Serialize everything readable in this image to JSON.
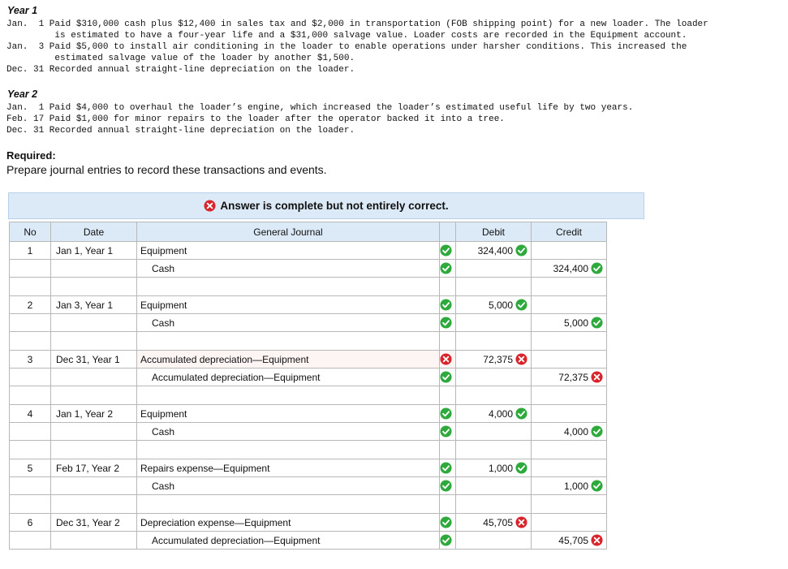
{
  "year1": {
    "title": "Year 1",
    "lines": [
      "Jan.  1 Paid $310,000 cash plus $12,400 in sales tax and $2,000 in transportation (FOB shipping point) for a new loader. The loader",
      "         is estimated to have a four-year life and a $31,000 salvage value. Loader costs are recorded in the Equipment account.",
      "Jan.  3 Paid $5,000 to install air conditioning in the loader to enable operations under harsher conditions. This increased the",
      "         estimated salvage value of the loader by another $1,500.",
      "Dec. 31 Recorded annual straight-line depreciation on the loader."
    ]
  },
  "year2": {
    "title": "Year 2",
    "lines": [
      "Jan.  1 Paid $4,000 to overhaul the loader’s engine, which increased the loader’s estimated useful life by two years.",
      "Feb. 17 Paid $1,000 for minor repairs to the loader after the operator backed it into a tree.",
      "Dec. 31 Recorded annual straight-line depreciation on the loader."
    ]
  },
  "required": {
    "title": "Required:",
    "text": "Prepare journal entries to record these transactions and events."
  },
  "banner": {
    "text": "Answer is complete but not entirely correct.",
    "icon": "x-circle-icon"
  },
  "table": {
    "headers": {
      "no": "No",
      "date": "Date",
      "journal": "General Journal",
      "debit": "Debit",
      "credit": "Credit"
    },
    "entries": [
      {
        "no": "1",
        "date": "Jan 1, Year 1",
        "debit_line": {
          "account": "Equipment",
          "status": "correct",
          "amount": "324,400",
          "amount_status": "correct"
        },
        "credit_line": {
          "account": "Cash",
          "status": "correct",
          "amount": "324,400",
          "amount_status": "correct"
        }
      },
      {
        "no": "2",
        "date": "Jan 3, Year 1",
        "debit_line": {
          "account": "Equipment",
          "status": "correct",
          "amount": "5,000",
          "amount_status": "correct"
        },
        "credit_line": {
          "account": "Cash",
          "status": "correct",
          "amount": "5,000",
          "amount_status": "correct"
        }
      },
      {
        "no": "3",
        "date": "Dec 31, Year 1",
        "debit_line": {
          "account": "Accumulated depreciation—Equipment",
          "status": "incorrect",
          "amount": "72,375",
          "amount_status": "incorrect"
        },
        "credit_line": {
          "account": "Accumulated depreciation—Equipment",
          "status": "correct",
          "amount": "72,375",
          "amount_status": "incorrect"
        }
      },
      {
        "no": "4",
        "date": "Jan 1, Year 2",
        "debit_line": {
          "account": "Equipment",
          "status": "correct",
          "amount": "4,000",
          "amount_status": "correct"
        },
        "credit_line": {
          "account": "Cash",
          "status": "correct",
          "amount": "4,000",
          "amount_status": "correct"
        }
      },
      {
        "no": "5",
        "date": "Feb 17, Year 2",
        "debit_line": {
          "account": "Repairs expense—Equipment",
          "status": "correct",
          "amount": "1,000",
          "amount_status": "correct"
        },
        "credit_line": {
          "account": "Cash",
          "status": "correct",
          "amount": "1,000",
          "amount_status": "correct"
        }
      },
      {
        "no": "6",
        "date": "Dec 31, Year 2",
        "debit_line": {
          "account": "Depreciation expense—Equipment",
          "status": "correct",
          "amount": "45,705",
          "amount_status": "incorrect"
        },
        "credit_line": {
          "account": "Accumulated depreciation—Equipment",
          "status": "correct",
          "amount": "45,705",
          "amount_status": "incorrect"
        }
      }
    ]
  },
  "colors": {
    "correct": "#2eaa3c",
    "incorrect": "#d9242b",
    "header_bg": "#dceaf7",
    "banner_bg": "#dceaf7"
  },
  "icons": {
    "correct": "check-circle-icon",
    "incorrect": "x-circle-icon"
  }
}
